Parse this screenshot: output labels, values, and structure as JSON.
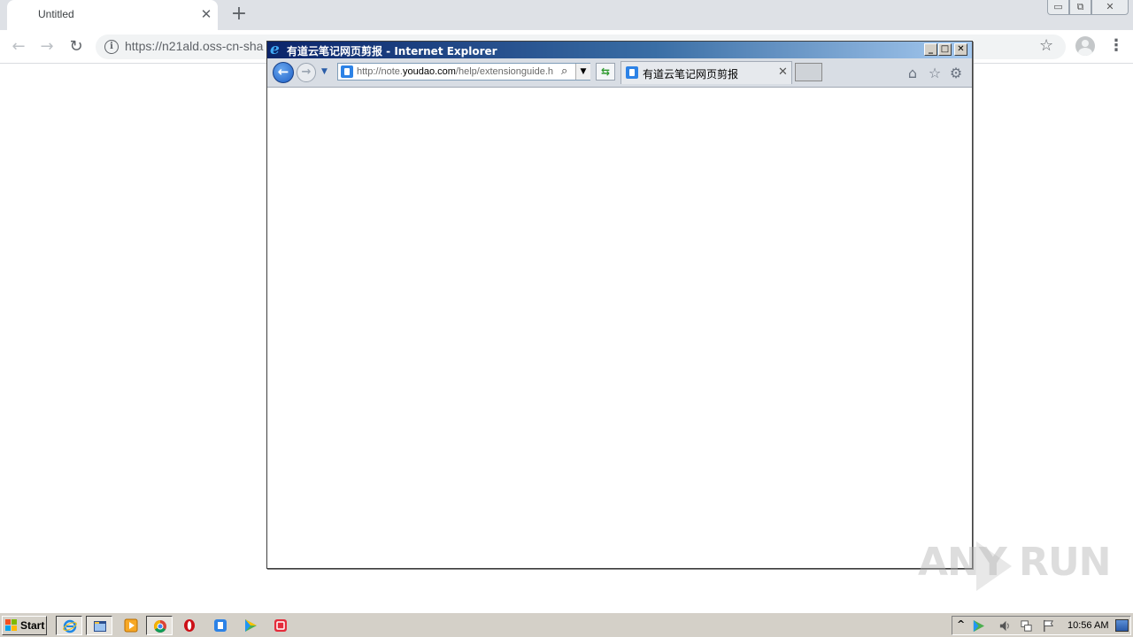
{
  "chrome": {
    "tab_title": "Untitled",
    "tab_close": "✕",
    "new_tab": "+",
    "url": "https://n21ald.oss-cn-sha",
    "window_controls": {
      "minimize": "▭",
      "restore": "⧉",
      "close": "✕"
    }
  },
  "ie": {
    "window_title": "有道云笔记网页剪报 - Internet Explorer",
    "address_url_prefix": "http://note.",
    "address_url_host": "youdao.com",
    "address_url_path": "/help/extensionguide.h",
    "tab_title": "有道云笔记网页剪报",
    "tab_close": "✕",
    "caption": {
      "minimize": "_",
      "maximize": "□",
      "close": "✕"
    }
  },
  "watermark": {
    "text": "ANY RUN"
  },
  "taskbar": {
    "start_label": "Start",
    "clock": "10:56 AM"
  },
  "colors": {
    "ie_title_gradient_start": "#0a246a",
    "ie_title_gradient_end": "#a6caf0",
    "chrome_tabstrip": "#dee1e6",
    "taskbar": "#d4d0c8"
  }
}
